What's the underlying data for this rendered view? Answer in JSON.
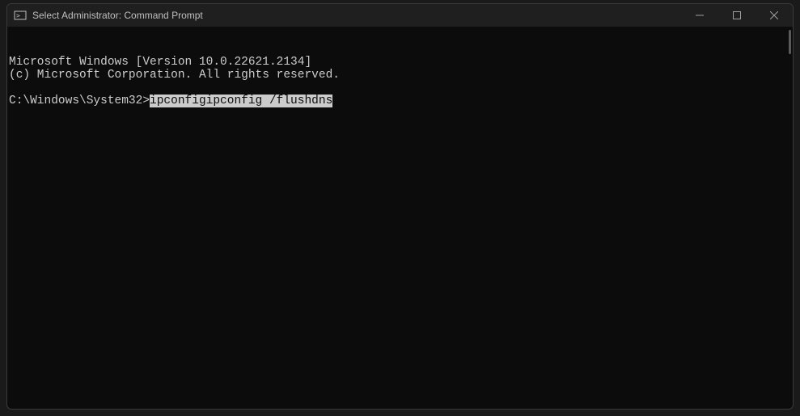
{
  "titlebar": {
    "title": "Select Administrator: Command Prompt"
  },
  "terminal": {
    "line1": "Microsoft Windows [Version 10.0.22621.2134]",
    "line2": "(c) Microsoft Corporation. All rights reserved.",
    "prompt": "C:\\Windows\\System32>",
    "command_selected": "ipconfigipconfig /flushdns"
  }
}
